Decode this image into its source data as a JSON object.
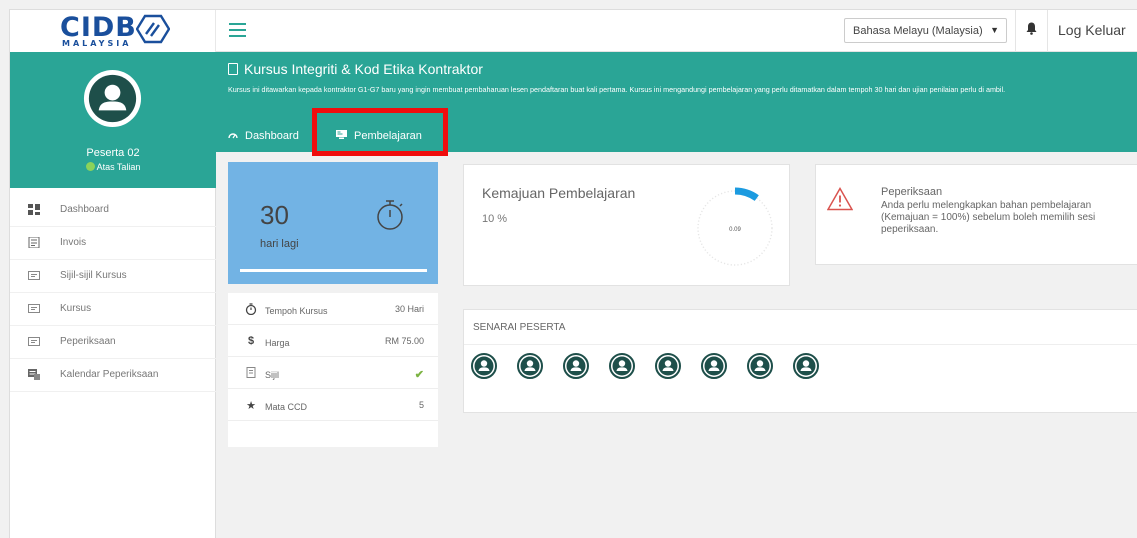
{
  "brand": {
    "logo_text": "CIDB",
    "logo_sub": "MALAYSIA",
    "color_primary": "#2aa596",
    "color_logo": "#1a4f9c"
  },
  "topbar": {
    "language": "Bahasa Melayu (Malaysia)",
    "logout": "Log Keluar",
    "menu_icon": "hamburger-icon",
    "bell_icon": "bell-icon"
  },
  "profile": {
    "name": "Peserta 02",
    "status": "Atas Talian"
  },
  "sidebar": {
    "items": [
      {
        "label": "Dashboard",
        "icon": "dashboard-icon"
      },
      {
        "label": "Invois",
        "icon": "invoice-icon"
      },
      {
        "label": "Sijil-sijil Kursus",
        "icon": "certificate-icon"
      },
      {
        "label": "Kursus",
        "icon": "course-icon"
      },
      {
        "label": "Peperiksaan",
        "icon": "exam-icon"
      },
      {
        "label": "Kalendar Peperiksaan",
        "icon": "calendar-icon"
      }
    ]
  },
  "course": {
    "title": "Kursus Integriti & Kod Etika Kontraktor",
    "description": "Kursus ini ditawarkan kepada kontraktor G1-G7 baru yang ingin membuat pembaharuan lesen pendaftaran buat kali pertama. Kursus ini mengandungi pembelajaran yang perlu ditamatkan dalam tempoh 30 hari dan ujian penilaian perlu di ambil.",
    "tabs": [
      {
        "label": "Dashboard",
        "icon": "dashboard-tab-icon"
      },
      {
        "label": "Pembelajaran",
        "icon": "learning-tab-icon",
        "highlighted": true
      }
    ]
  },
  "countdown": {
    "number": "30",
    "label": "hari lagi",
    "icon": "stopwatch-icon"
  },
  "info": [
    {
      "label": "Tempoh Kursus",
      "value": "30 Hari",
      "icon": "timer-icon"
    },
    {
      "label": "Harga",
      "value": "RM 75.00",
      "icon": "dollar-icon"
    },
    {
      "label": "Sijil",
      "value": "",
      "icon": "certificate-icon",
      "checked": true
    },
    {
      "label": "Mata CCD",
      "value": "5",
      "icon": "star-icon"
    }
  ],
  "progress": {
    "title": "Kemajuan Pembelajaran",
    "value": "10 %",
    "gauge_label": "0.09",
    "fraction": 0.1
  },
  "exam": {
    "title": "Peperiksaan",
    "text": "Anda perlu melengkapkan bahan pembelajaran (Kemajuan = 100%) sebelum boleh memilih sesi peperiksaan.",
    "icon": "warning-icon"
  },
  "participants": {
    "title": "SENARAI PESERTA",
    "count": 8
  }
}
